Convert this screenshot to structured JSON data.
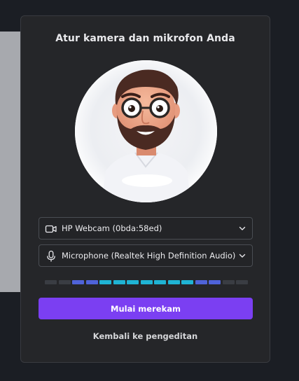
{
  "modal": {
    "title": "Atur kamera dan mikrofon Anda"
  },
  "camera_select": {
    "icon": "video-camera-icon",
    "value": "HP Webcam (0bda:58ed)"
  },
  "microphone_select": {
    "icon": "microphone-icon",
    "value": "Microphone (Realtek High Definition Audio)"
  },
  "level_meter": {
    "segments_total": 15,
    "segments_active": 11,
    "colors": {
      "inactive": "#3a3d43",
      "low": "#4f63d9",
      "mid": "#1fb4d4"
    }
  },
  "primary_button": {
    "label": "Mulai merekam"
  },
  "secondary_link": {
    "label": "Kembali ke pengeditan"
  },
  "colors": {
    "accent": "#7b3ff2",
    "modal_bg": "#252629",
    "page_bg": "#1b1e24"
  }
}
